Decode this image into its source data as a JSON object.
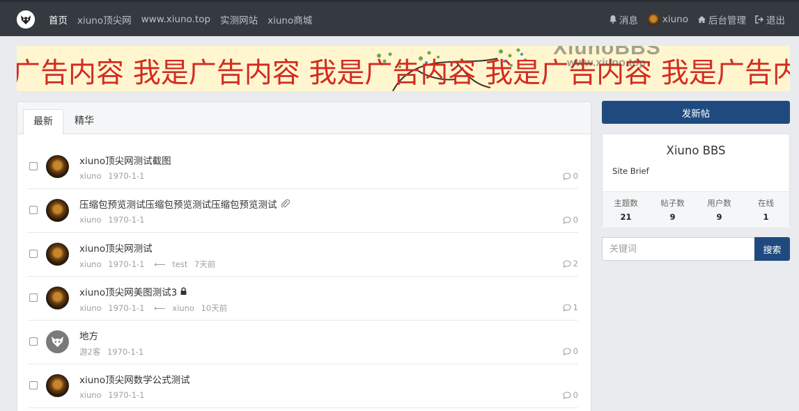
{
  "nav": {
    "left": [
      "首页",
      "xiuno顶尖网",
      "www.xiuno.top",
      "实测网站",
      "xiuno商城"
    ],
    "right": {
      "messages": "消息",
      "user": "xiuno",
      "admin": "后台管理",
      "logout": "退出"
    }
  },
  "banner": {
    "text": "我是广告内容  我是广告内容  我是广告内容  我是广告内容  我是广告内容",
    "watermark": "XiunoBBS",
    "watermark_url": "www.xiuno.top"
  },
  "tabs": [
    "最新",
    "精华"
  ],
  "threads": [
    {
      "title": "xiuno顶尖网测试截图",
      "author": "xiuno",
      "date": "1970-1-1",
      "last_user": "",
      "last_time": "",
      "replies": "0",
      "guest": false
    },
    {
      "title": "压缩包预览测试压缩包预览测试压缩包预览测试",
      "author": "xiuno",
      "date": "1970-1-1",
      "last_user": "",
      "last_time": "",
      "replies": "0",
      "guest": false
    },
    {
      "title": "xiuno顶尖网测试",
      "author": "xiuno",
      "date": "1970-1-1",
      "last_user": "test",
      "last_time": "7天前",
      "replies": "2",
      "guest": false
    },
    {
      "title": "xiuno顶尖网美图测试3",
      "author": "xiuno",
      "date": "1970-1-1",
      "last_user": "xiuno",
      "last_time": "10天前",
      "replies": "1",
      "guest": false
    },
    {
      "title": "地方",
      "author": "游2客",
      "date": "1970-1-1",
      "last_user": "",
      "last_time": "",
      "replies": "0",
      "guest": true
    },
    {
      "title": "xiuno顶尖网数学公式测试",
      "author": "xiuno",
      "date": "1970-1-1",
      "last_user": "",
      "last_time": "",
      "replies": "0",
      "guest": false
    }
  ],
  "sidebar": {
    "new_thread": "发新帖",
    "site_name": "Xiuno BBS",
    "site_brief": "Site Brief",
    "stats": [
      {
        "label": "主题数",
        "value": "21"
      },
      {
        "label": "帖子数",
        "value": "9"
      },
      {
        "label": "用户数",
        "value": "9"
      },
      {
        "label": "在线",
        "value": "1"
      }
    ],
    "search_placeholder": "关键词",
    "search_button": "搜索"
  },
  "colors": {
    "navbar": "#343a40",
    "primary": "#1f4a80",
    "banner_text": "#d42b20",
    "banner_bg": "#fff6cf"
  }
}
